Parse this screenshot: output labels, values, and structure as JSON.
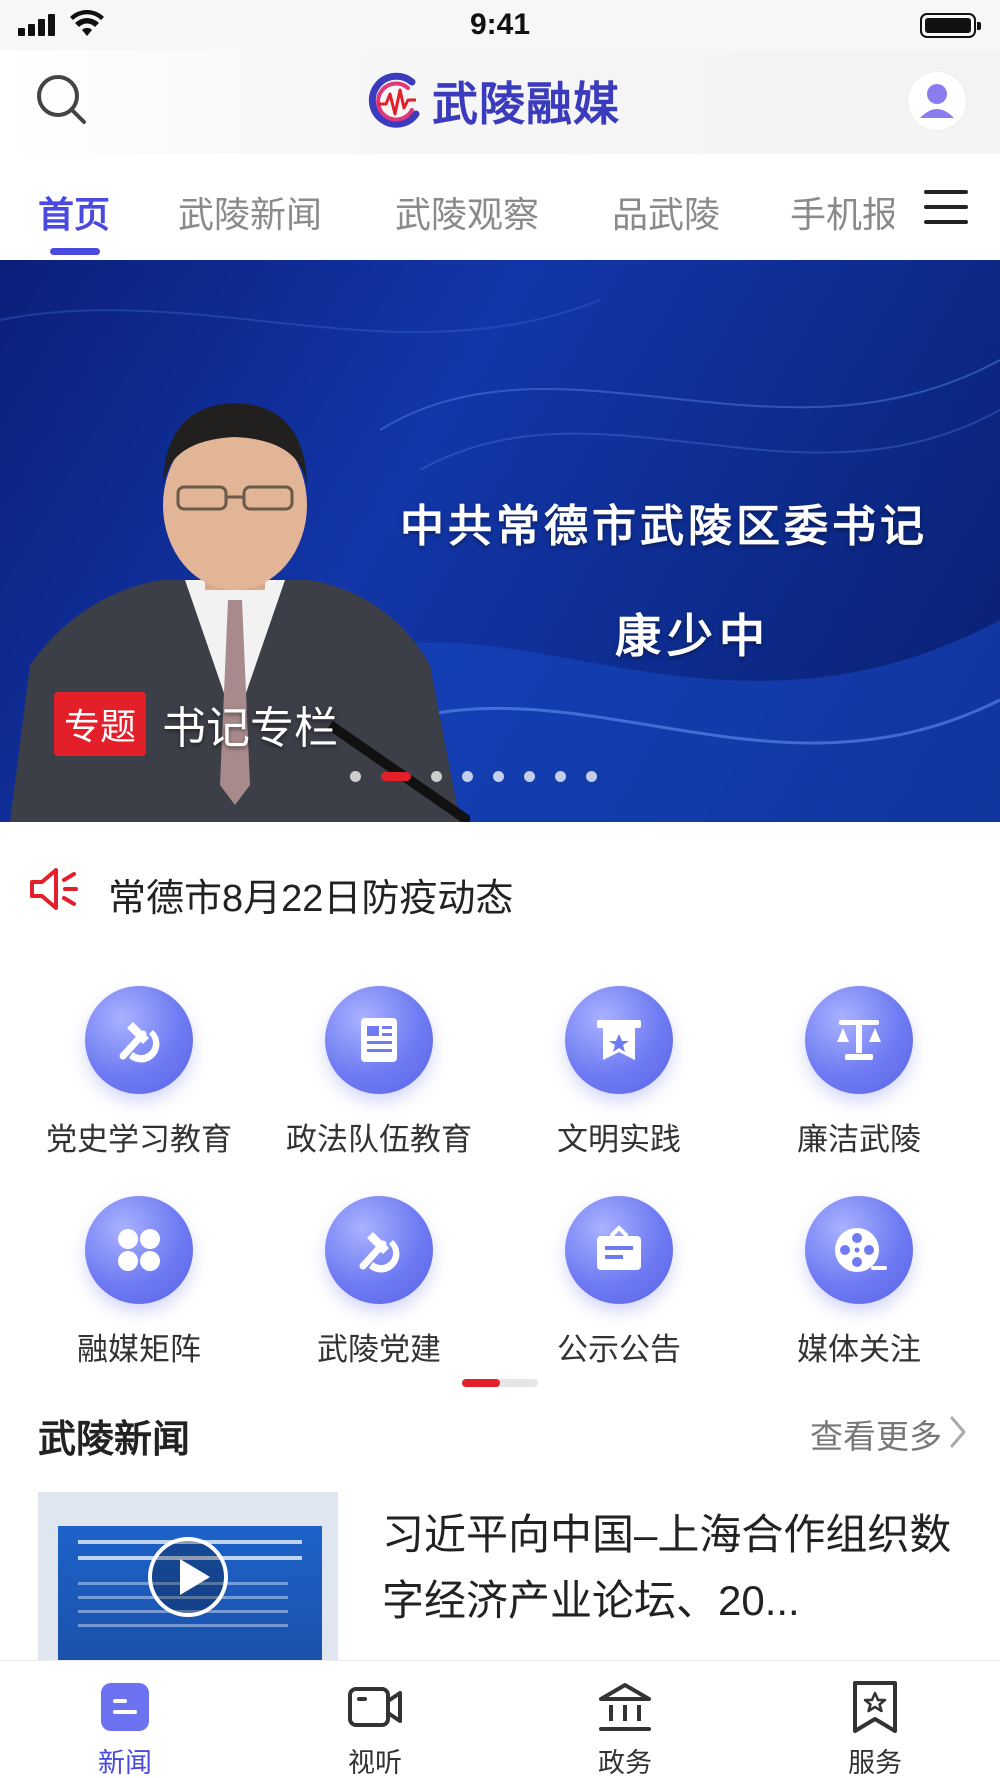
{
  "status_bar": {
    "time": "9:41"
  },
  "header": {
    "app_name": "武陵融媒",
    "search_icon": "search-icon",
    "avatar_icon": "user-avatar-icon",
    "accent_color": "#4a4ae0"
  },
  "tabs": {
    "items": [
      {
        "label": "首页",
        "active": true
      },
      {
        "label": "武陵新闻",
        "active": false
      },
      {
        "label": "武陵观察",
        "active": false
      },
      {
        "label": "品武陵",
        "active": false
      },
      {
        "label": "手机报",
        "active": false
      }
    ],
    "menu_icon": "hamburger-menu-icon"
  },
  "banner": {
    "headline": "中共常德市武陵区委书记",
    "name": "康少中",
    "tag": "专题",
    "title": "书记专栏",
    "dot_count": 8,
    "active_dot": 2
  },
  "notice": {
    "icon": "speaker-icon",
    "text": "常德市8月22日防疫动态"
  },
  "quick_grid": {
    "items": [
      {
        "label": "党史学习教育",
        "icon": "hammer-sickle-icon"
      },
      {
        "label": "政法队伍教育",
        "icon": "document-icon"
      },
      {
        "label": "文明实践",
        "icon": "star-banner-icon"
      },
      {
        "label": "廉洁武陵",
        "icon": "scales-icon"
      },
      {
        "label": "融媒矩阵",
        "icon": "four-squares-icon"
      },
      {
        "label": "武陵党建",
        "icon": "hammer-sickle-icon"
      },
      {
        "label": "公示公告",
        "icon": "notice-board-icon"
      },
      {
        "label": "媒体关注",
        "icon": "film-reel-icon"
      }
    ],
    "page": 1,
    "page_count": 2
  },
  "news_section": {
    "title": "武陵新闻",
    "see_more": "查看更多",
    "items": [
      {
        "title": "习近平向中国–上海合作组织数字经济产业论坛、20...",
        "thumb_text": "习近平向中国–上海合作组织数字经济产业论坛、2021中国国际智能产业博览会致贺信",
        "has_video": true
      }
    ]
  },
  "bottom_nav": {
    "items": [
      {
        "label": "新闻",
        "icon": "news-icon",
        "active": true
      },
      {
        "label": "视听",
        "icon": "video-camera-icon",
        "active": false
      },
      {
        "label": "政务",
        "icon": "government-building-icon",
        "active": false
      },
      {
        "label": "服务",
        "icon": "bookmark-star-icon",
        "active": false
      }
    ]
  }
}
